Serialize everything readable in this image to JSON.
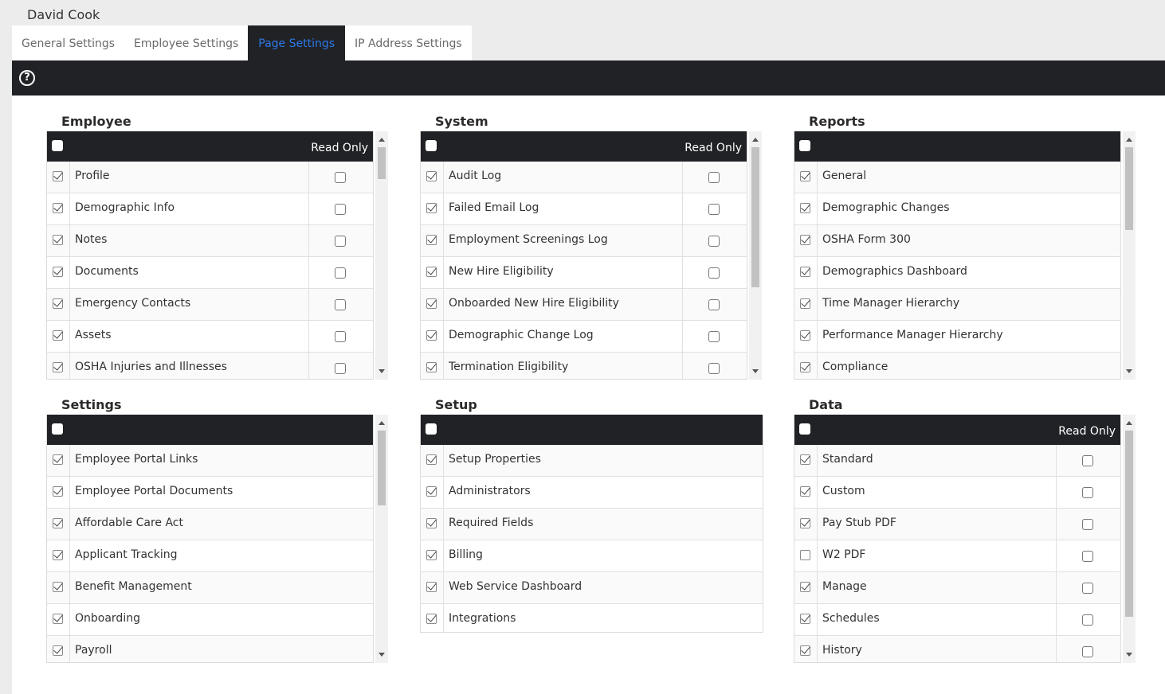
{
  "user": {
    "name": "David Cook"
  },
  "tabs": [
    {
      "label": "General Settings"
    },
    {
      "label": "Employee Settings"
    },
    {
      "label": "Page Settings",
      "active": true
    },
    {
      "label": "IP Address Settings"
    }
  ],
  "toolbar": {
    "help_icon": "question-circle-icon"
  },
  "colors": {
    "dark": "#202226",
    "active_tab": "#2f79e6"
  },
  "panels": {
    "employee": {
      "title": "Employee",
      "read_only_label": "Read Only",
      "rows": [
        {
          "label": "Profile"
        },
        {
          "label": "Demographic Info"
        },
        {
          "label": "Notes"
        },
        {
          "label": "Documents"
        },
        {
          "label": "Emergency Contacts"
        },
        {
          "label": "Assets"
        },
        {
          "label": "OSHA Injuries and Illnesses"
        }
      ]
    },
    "system": {
      "title": "System",
      "read_only_label": "Read Only",
      "rows": [
        {
          "label": "Audit Log"
        },
        {
          "label": "Failed Email Log"
        },
        {
          "label": "Employment Screenings Log"
        },
        {
          "label": "New Hire Eligibility"
        },
        {
          "label": "Onboarded New Hire Eligibility"
        },
        {
          "label": "Demographic Change Log"
        },
        {
          "label": "Termination Eligibility"
        }
      ]
    },
    "reports": {
      "title": "Reports",
      "rows": [
        {
          "label": "General"
        },
        {
          "label": "Demographic Changes"
        },
        {
          "label": "OSHA Form 300"
        },
        {
          "label": "Demographics Dashboard"
        },
        {
          "label": "Time Manager Hierarchy"
        },
        {
          "label": "Performance Manager Hierarchy"
        },
        {
          "label": "Compliance"
        }
      ]
    },
    "settings": {
      "title": "Settings",
      "rows": [
        {
          "label": "Employee Portal Links"
        },
        {
          "label": "Employee Portal Documents"
        },
        {
          "label": "Affordable Care Act"
        },
        {
          "label": "Applicant Tracking"
        },
        {
          "label": "Benefit Management"
        },
        {
          "label": "Onboarding"
        },
        {
          "label": "Payroll"
        }
      ]
    },
    "setup": {
      "title": "Setup",
      "rows": [
        {
          "label": "Setup Properties"
        },
        {
          "label": "Administrators"
        },
        {
          "label": "Required Fields"
        },
        {
          "label": "Billing"
        },
        {
          "label": "Web Service Dashboard"
        },
        {
          "label": "Integrations"
        }
      ]
    },
    "data": {
      "title": "Data",
      "read_only_label": "Read Only",
      "rows": [
        {
          "label": "Standard"
        },
        {
          "label": "Custom"
        },
        {
          "label": "Pay Stub PDF"
        },
        {
          "label": "W2 PDF",
          "checked": false
        },
        {
          "label": "Manage"
        },
        {
          "label": "Schedules"
        },
        {
          "label": "History"
        }
      ]
    }
  }
}
